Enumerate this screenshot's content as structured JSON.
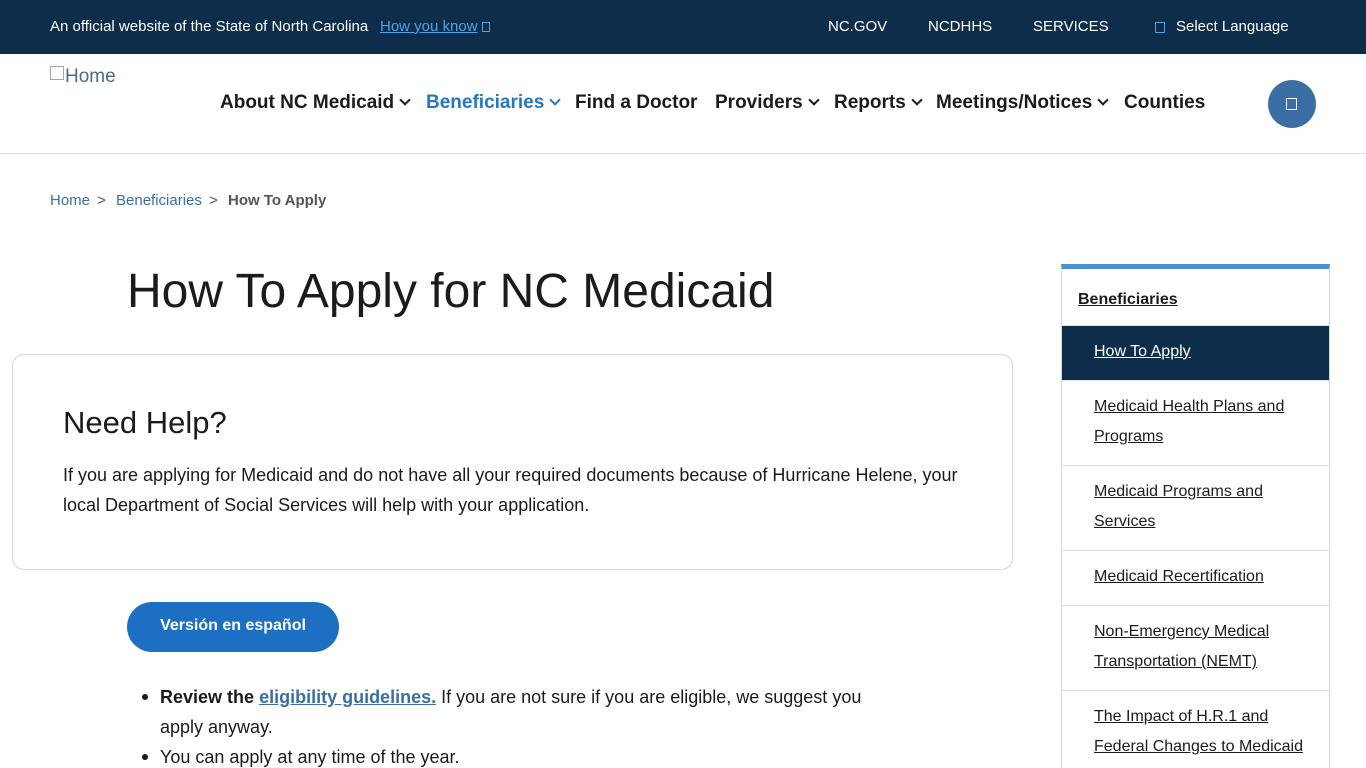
{
  "topbar": {
    "official_text": "An official website of the State of North Carolina",
    "how_you_know": "How you know",
    "links": [
      "NC.GOV",
      "NCDHHS",
      "SERVICES"
    ],
    "language": "Select Language"
  },
  "header": {
    "logo_alt": "Home",
    "nav": [
      {
        "label": "About NC Medicaid",
        "dropdown": true
      },
      {
        "label": "Beneficiaries",
        "dropdown": true,
        "active": true
      },
      {
        "label": "Find a Doctor",
        "dropdown": false
      },
      {
        "label": "Providers",
        "dropdown": true
      },
      {
        "label": "Reports",
        "dropdown": true
      },
      {
        "label": "Meetings/Notices",
        "dropdown": true
      },
      {
        "label": "Counties",
        "dropdown": false
      }
    ],
    "search_icon": "search-icon"
  },
  "breadcrumb": {
    "home": "Home",
    "sep": ">",
    "section": "Beneficiaries",
    "current": "How To Apply"
  },
  "page_title": "How To Apply for NC Medicaid",
  "help": {
    "heading": "Need Help?",
    "text": "If you are applying for Medicaid and do not have all your required documents because of Hurricane Helene, your local Department of Social Services will help with your application."
  },
  "spanish_button": "Versión en español",
  "bullets": [
    {
      "bold": "Review the",
      "link": "eligibility guidelines.",
      "rest": " If you are not sure if you are eligible, we suggest you apply anyway."
    },
    {
      "text": "You can apply at any time of the year."
    }
  ],
  "sidebar": {
    "heading": "Beneficiaries",
    "items": [
      {
        "label": "How To Apply",
        "active": true
      },
      {
        "label": "Medicaid Health Plans and Programs"
      },
      {
        "label": "Medicaid Programs and Services"
      },
      {
        "label": "Medicaid Recertification"
      },
      {
        "label": "Non-Emergency Medical Transportation (NEMT)"
      },
      {
        "label": "The Impact of H.R.1 and Federal Changes to Medicaid"
      }
    ]
  },
  "colors": {
    "topbar_bg": "#0d2d4b",
    "link_blue": "#3a6ea5",
    "active_nav": "#2378c3",
    "button_blue": "#1d6fc4",
    "sidebar_accent": "#4a90d9"
  }
}
